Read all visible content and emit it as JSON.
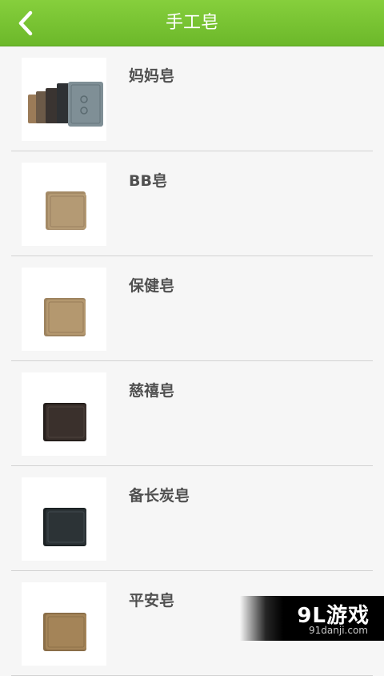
{
  "header": {
    "title": "手工皂",
    "back_icon": "chevron-left-icon"
  },
  "items": [
    {
      "name": "妈妈皂",
      "soap_color": "#7f8f96",
      "stacked": true
    },
    {
      "name": "BB皂",
      "soap_color": "#b49a74"
    },
    {
      "name": "保健皂",
      "soap_color": "#b4986f"
    },
    {
      "name": "慈禧皂",
      "soap_color": "#3a302c"
    },
    {
      "name": "备长炭皂",
      "soap_color": "#2c3336"
    },
    {
      "name": "平安皂",
      "soap_color": "#a48458"
    }
  ],
  "watermark": {
    "logo": "9L游戏",
    "url": "91danji.com"
  },
  "colors": {
    "accent": "#78c032",
    "text": "#505050",
    "background": "#f6f6f6"
  }
}
